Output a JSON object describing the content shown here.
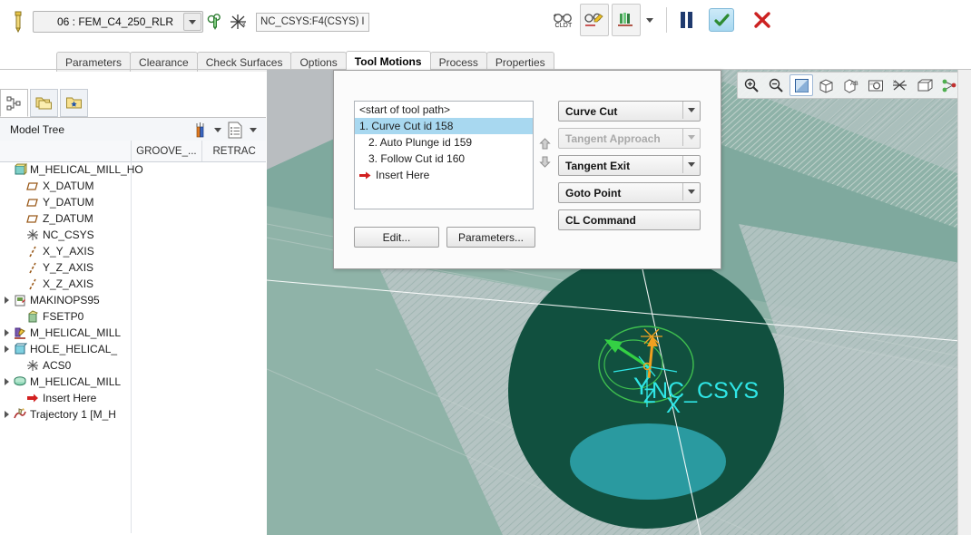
{
  "topbar": {
    "tool_icon": "endmill-tool-icon",
    "workcenter_value": "06 : FEM_C4_250_RLR",
    "workcenter_dropdown_icon": "chevron-down-icon",
    "ref_icon_1": "machine-axes-icon",
    "ref_icon_2": "coordinate-system-icon",
    "csys_value": "NC_CSYS:F4(CSYS) I",
    "buttons": [
      {
        "name": "cldt-button",
        "label": "CLDT",
        "icon": "glasses-icon"
      },
      {
        "name": "cl-edit-button",
        "label": "",
        "icon": "glasses-pencil-icon"
      },
      {
        "name": "tool-display-button",
        "label": "",
        "icon": "tool-bundle-icon"
      }
    ],
    "tool_display_dropdown_icon": "chevron-down-icon",
    "pause_label": "pause-button",
    "accept_label": "check-button",
    "cancel_label": "cancel-button"
  },
  "tabs": [
    {
      "label": "Parameters",
      "active": false
    },
    {
      "label": "Clearance",
      "active": false
    },
    {
      "label": "Check Surfaces",
      "active": false
    },
    {
      "label": "Options",
      "active": false
    },
    {
      "label": "Tool Motions",
      "active": true
    },
    {
      "label": "Process",
      "active": false
    },
    {
      "label": "Properties",
      "active": false
    }
  ],
  "left_panel": {
    "tabs": [
      {
        "name": "model-tree-tab",
        "icon": "tree-nodes-icon",
        "selected": true
      },
      {
        "name": "folder-browser-tab",
        "icon": "folders-icon",
        "selected": false
      },
      {
        "name": "favorites-folder-tab",
        "icon": "folder-star-icon",
        "selected": false
      }
    ],
    "title": "Model Tree",
    "header_icons": [
      {
        "name": "filter-tools-icon",
        "icon": "wrench-filter-icon"
      },
      {
        "name": "settings-list-icon",
        "icon": "list-settings-icon"
      }
    ],
    "columns": [
      "",
      "GROOVE_...",
      "RETRAC"
    ],
    "tree": [
      {
        "label": "M_HELICAL_MILL_HO",
        "indent": 0,
        "icon": "part-icon",
        "expandable": false
      },
      {
        "label": "X_DATUM",
        "indent": 1,
        "icon": "datum-plane-icon",
        "expandable": false
      },
      {
        "label": "Y_DATUM",
        "indent": 1,
        "icon": "datum-plane-icon",
        "expandable": false
      },
      {
        "label": "Z_DATUM",
        "indent": 1,
        "icon": "datum-plane-icon",
        "expandable": false
      },
      {
        "label": "NC_CSYS",
        "indent": 1,
        "icon": "csys-icon",
        "expandable": false
      },
      {
        "label": "X_Y_AXIS",
        "indent": 1,
        "icon": "axis-icon",
        "expandable": false
      },
      {
        "label": "Y_Z_AXIS",
        "indent": 1,
        "icon": "axis-icon",
        "expandable": false
      },
      {
        "label": "X_Z_AXIS",
        "indent": 1,
        "icon": "axis-icon",
        "expandable": false
      },
      {
        "label": "MAKINOPS95",
        "indent": 0,
        "icon": "workcenter-icon",
        "expandable": true
      },
      {
        "label": "FSETP0",
        "indent": 1,
        "icon": "fixture-setup-icon",
        "expandable": false
      },
      {
        "label": "M_HELICAL_MILL",
        "indent": 0,
        "icon": "mill-op-icon",
        "expandable": true
      },
      {
        "label": "HOLE_HELICAL_",
        "indent": 0,
        "icon": "hole-feature-icon",
        "expandable": true
      },
      {
        "label": "ACS0",
        "indent": 1,
        "icon": "csys-icon",
        "expandable": false
      },
      {
        "label": "M_HELICAL_MILL",
        "indent": 0,
        "icon": "mill-volume-icon",
        "expandable": true
      },
      {
        "label": "Insert Here",
        "indent": 1,
        "icon": "red-arrow-icon",
        "expandable": false
      },
      {
        "label": "Trajectory 1 [M_H",
        "indent": 0,
        "icon": "trajectory-icon",
        "expandable": true
      }
    ]
  },
  "dialog": {
    "motion_list": [
      {
        "label": "<start of tool path>",
        "indent": false,
        "selected": false,
        "arrow": false
      },
      {
        "label": "1. Curve Cut id 158",
        "indent": false,
        "selected": true,
        "arrow": false
      },
      {
        "label": "2. Auto Plunge id 159",
        "indent": true,
        "selected": false,
        "arrow": false
      },
      {
        "label": "3. Follow Cut id 160",
        "indent": true,
        "selected": false,
        "arrow": false
      },
      {
        "label": "Insert Here",
        "indent": false,
        "selected": false,
        "arrow": true
      }
    ],
    "edit_button": "Edit...",
    "parameters_button": "Parameters...",
    "dropdowns": [
      {
        "name": "curve-cut-dropdown",
        "label": "Curve Cut",
        "disabled": false,
        "has_arrow": true
      },
      {
        "name": "tangent-approach-dropdown",
        "label": "Tangent Approach",
        "disabled": true,
        "has_arrow": true
      },
      {
        "name": "tangent-exit-dropdown",
        "label": "Tangent Exit",
        "disabled": false,
        "has_arrow": true
      },
      {
        "name": "goto-point-dropdown",
        "label": "Goto Point",
        "disabled": false,
        "has_arrow": true
      },
      {
        "name": "cl-command-button",
        "label": "CL Command",
        "disabled": false,
        "has_arrow": false
      }
    ],
    "move_up_icon": "arrow-up-icon",
    "move_down_icon": "arrow-down-icon"
  },
  "viewport": {
    "toolbar_icons": [
      {
        "name": "zoom-in-button",
        "icon": "magnifier-plus-icon"
      },
      {
        "name": "zoom-out-button",
        "icon": "magnifier-minus-icon"
      },
      {
        "name": "display-style-button",
        "icon": "shaded-square-icon"
      },
      {
        "name": "view-orientation-button",
        "icon": "cube-icon"
      },
      {
        "name": "annotation-display-button",
        "icon": "cube-ab-icon"
      },
      {
        "name": "screen-capture-button",
        "icon": "camera-icon"
      },
      {
        "name": "datum-display-button",
        "icon": "datum-off-icon"
      },
      {
        "name": "layer-display-button",
        "icon": "box-icon"
      },
      {
        "name": "relations-button",
        "icon": "node-graph-icon"
      }
    ],
    "csys_label": "NC_CSYS",
    "axis_labels": {
      "x": "X",
      "y": "Y",
      "z": "Z"
    },
    "colors": {
      "background_green": "#7fa99e",
      "part_dark": "#11503f",
      "part_teal": "#2a9aa0",
      "hatch_gray": "#b9c6c6",
      "toolpath_green": "#38d043",
      "csys_cyan": "#2fe6e6",
      "axis_orange": "#f0a020"
    }
  }
}
